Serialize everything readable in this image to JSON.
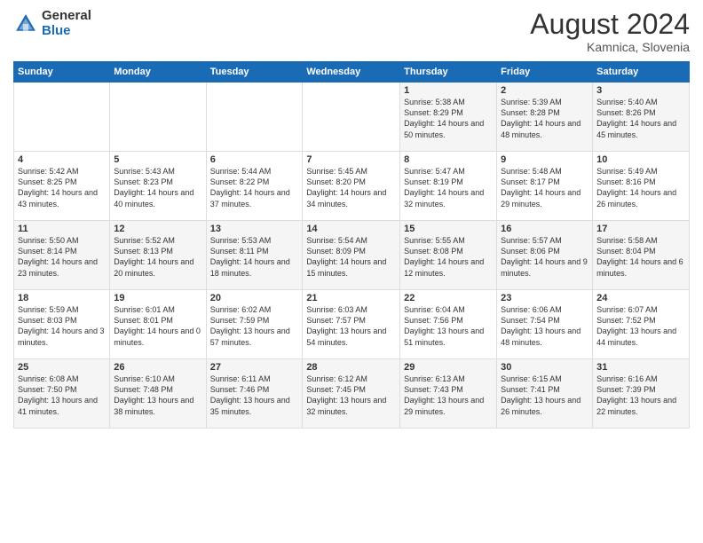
{
  "logo": {
    "general": "General",
    "blue": "Blue"
  },
  "title": {
    "month_year": "August 2024",
    "location": "Kamnica, Slovenia"
  },
  "headers": [
    "Sunday",
    "Monday",
    "Tuesday",
    "Wednesday",
    "Thursday",
    "Friday",
    "Saturday"
  ],
  "weeks": [
    [
      {
        "day": "",
        "info": ""
      },
      {
        "day": "",
        "info": ""
      },
      {
        "day": "",
        "info": ""
      },
      {
        "day": "",
        "info": ""
      },
      {
        "day": "1",
        "info": "Sunrise: 5:38 AM\nSunset: 8:29 PM\nDaylight: 14 hours and 50 minutes."
      },
      {
        "day": "2",
        "info": "Sunrise: 5:39 AM\nSunset: 8:28 PM\nDaylight: 14 hours and 48 minutes."
      },
      {
        "day": "3",
        "info": "Sunrise: 5:40 AM\nSunset: 8:26 PM\nDaylight: 14 hours and 45 minutes."
      }
    ],
    [
      {
        "day": "4",
        "info": "Sunrise: 5:42 AM\nSunset: 8:25 PM\nDaylight: 14 hours and 43 minutes."
      },
      {
        "day": "5",
        "info": "Sunrise: 5:43 AM\nSunset: 8:23 PM\nDaylight: 14 hours and 40 minutes."
      },
      {
        "day": "6",
        "info": "Sunrise: 5:44 AM\nSunset: 8:22 PM\nDaylight: 14 hours and 37 minutes."
      },
      {
        "day": "7",
        "info": "Sunrise: 5:45 AM\nSunset: 8:20 PM\nDaylight: 14 hours and 34 minutes."
      },
      {
        "day": "8",
        "info": "Sunrise: 5:47 AM\nSunset: 8:19 PM\nDaylight: 14 hours and 32 minutes."
      },
      {
        "day": "9",
        "info": "Sunrise: 5:48 AM\nSunset: 8:17 PM\nDaylight: 14 hours and 29 minutes."
      },
      {
        "day": "10",
        "info": "Sunrise: 5:49 AM\nSunset: 8:16 PM\nDaylight: 14 hours and 26 minutes."
      }
    ],
    [
      {
        "day": "11",
        "info": "Sunrise: 5:50 AM\nSunset: 8:14 PM\nDaylight: 14 hours and 23 minutes."
      },
      {
        "day": "12",
        "info": "Sunrise: 5:52 AM\nSunset: 8:13 PM\nDaylight: 14 hours and 20 minutes."
      },
      {
        "day": "13",
        "info": "Sunrise: 5:53 AM\nSunset: 8:11 PM\nDaylight: 14 hours and 18 minutes."
      },
      {
        "day": "14",
        "info": "Sunrise: 5:54 AM\nSunset: 8:09 PM\nDaylight: 14 hours and 15 minutes."
      },
      {
        "day": "15",
        "info": "Sunrise: 5:55 AM\nSunset: 8:08 PM\nDaylight: 14 hours and 12 minutes."
      },
      {
        "day": "16",
        "info": "Sunrise: 5:57 AM\nSunset: 8:06 PM\nDaylight: 14 hours and 9 minutes."
      },
      {
        "day": "17",
        "info": "Sunrise: 5:58 AM\nSunset: 8:04 PM\nDaylight: 14 hours and 6 minutes."
      }
    ],
    [
      {
        "day": "18",
        "info": "Sunrise: 5:59 AM\nSunset: 8:03 PM\nDaylight: 14 hours and 3 minutes."
      },
      {
        "day": "19",
        "info": "Sunrise: 6:01 AM\nSunset: 8:01 PM\nDaylight: 14 hours and 0 minutes."
      },
      {
        "day": "20",
        "info": "Sunrise: 6:02 AM\nSunset: 7:59 PM\nDaylight: 13 hours and 57 minutes."
      },
      {
        "day": "21",
        "info": "Sunrise: 6:03 AM\nSunset: 7:57 PM\nDaylight: 13 hours and 54 minutes."
      },
      {
        "day": "22",
        "info": "Sunrise: 6:04 AM\nSunset: 7:56 PM\nDaylight: 13 hours and 51 minutes."
      },
      {
        "day": "23",
        "info": "Sunrise: 6:06 AM\nSunset: 7:54 PM\nDaylight: 13 hours and 48 minutes."
      },
      {
        "day": "24",
        "info": "Sunrise: 6:07 AM\nSunset: 7:52 PM\nDaylight: 13 hours and 44 minutes."
      }
    ],
    [
      {
        "day": "25",
        "info": "Sunrise: 6:08 AM\nSunset: 7:50 PM\nDaylight: 13 hours and 41 minutes."
      },
      {
        "day": "26",
        "info": "Sunrise: 6:10 AM\nSunset: 7:48 PM\nDaylight: 13 hours and 38 minutes."
      },
      {
        "day": "27",
        "info": "Sunrise: 6:11 AM\nSunset: 7:46 PM\nDaylight: 13 hours and 35 minutes."
      },
      {
        "day": "28",
        "info": "Sunrise: 6:12 AM\nSunset: 7:45 PM\nDaylight: 13 hours and 32 minutes."
      },
      {
        "day": "29",
        "info": "Sunrise: 6:13 AM\nSunset: 7:43 PM\nDaylight: 13 hours and 29 minutes."
      },
      {
        "day": "30",
        "info": "Sunrise: 6:15 AM\nSunset: 7:41 PM\nDaylight: 13 hours and 26 minutes."
      },
      {
        "day": "31",
        "info": "Sunrise: 6:16 AM\nSunset: 7:39 PM\nDaylight: 13 hours and 22 minutes."
      }
    ]
  ]
}
